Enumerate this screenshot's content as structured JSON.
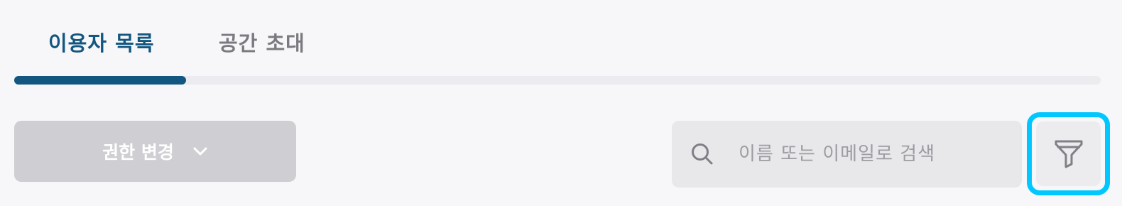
{
  "tabs": [
    {
      "label": "이용자 목록",
      "active": true
    },
    {
      "label": "공간 초대",
      "active": false
    }
  ],
  "toolbar": {
    "role_change_label": "권한 변경",
    "role_change_icon": "chevron-down-icon",
    "search_placeholder": "이름 또는 이메일로 검색",
    "search_value": "",
    "search_icon": "search-icon",
    "filter_icon": "filter-icon"
  },
  "colors": {
    "accent": "#135780",
    "focus_ring": "#00c7ff",
    "disabled_button": "#cfced2"
  }
}
